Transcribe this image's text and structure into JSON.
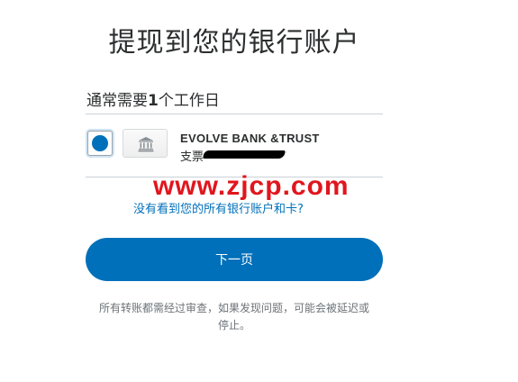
{
  "page": {
    "title": "提现到您的银行账户",
    "timing_prefix": "通常需要",
    "timing_number": "1",
    "timing_suffix": "个工作日"
  },
  "account": {
    "selected": true,
    "icon": "bank-icon",
    "bank_name": "EVOLVE BANK &TRUST",
    "type": "支票"
  },
  "watermark": "www.zjcp.com",
  "links": {
    "missing_accounts": "没有看到您的所有银行账户和卡?"
  },
  "actions": {
    "next_label": "下一页"
  },
  "notice": {
    "line1": "所有转账都需经过审查，如果发现问题，可能会被延迟或",
    "line2": "停止。"
  },
  "colors": {
    "primary": "#0070ba",
    "watermark": "#e0161e",
    "text": "#2c2e2f",
    "muted": "#6c7378"
  }
}
